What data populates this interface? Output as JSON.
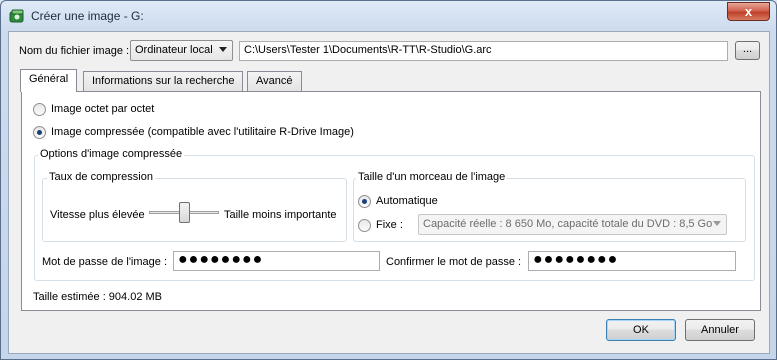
{
  "window": {
    "title": "Créer une image - G:",
    "close_symbol": "x"
  },
  "icons": {
    "app": "disk-image-icon",
    "close": "close-icon",
    "dropdown": "chevron-down-icon"
  },
  "file": {
    "label": "Nom du fichier image :",
    "location_value": "Ordinateur local",
    "path_value": "C:\\Users\\Tester 1\\Documents\\R-TT\\R-Studio\\G.arc",
    "browse_label": "..."
  },
  "tabs": [
    {
      "label": "Général",
      "active": true
    },
    {
      "label": "Informations sur la recherche",
      "active": false
    },
    {
      "label": "Avancé",
      "active": false
    }
  ],
  "general": {
    "radio_byte": "Image octet par octet",
    "radio_compressed": "Image compressée (compatible avec l'utilitaire R-Drive Image)",
    "options_title": "Options d'image compressée",
    "compression": {
      "title": "Taux de compression",
      "left_label": "Vitesse plus élevée",
      "right_label": "Taille moins importante",
      "level": 0.5
    },
    "chunk": {
      "title": "Taille d'un morceau de l'image",
      "auto_label": "Automatique",
      "fixed_label": "Fixe :",
      "fixed_value": "Capacité réelle : 8 650 Mo, capacité totale du DVD : 8,5 Go"
    },
    "password_label": "Mot de passe de l'image :",
    "password_value": "●●●●●●●●",
    "confirm_label": "Confirmer le mot de passe :",
    "confirm_value": "●●●●●●●●",
    "estimated_size": "Taille estimée : 904.02 MB"
  },
  "buttons": {
    "ok_label": "OK",
    "cancel_label": "Annuler"
  },
  "colors": {
    "titlebar": "#cddbee",
    "close": "#c0402a",
    "radio_dot": "#1b3f7a"
  }
}
